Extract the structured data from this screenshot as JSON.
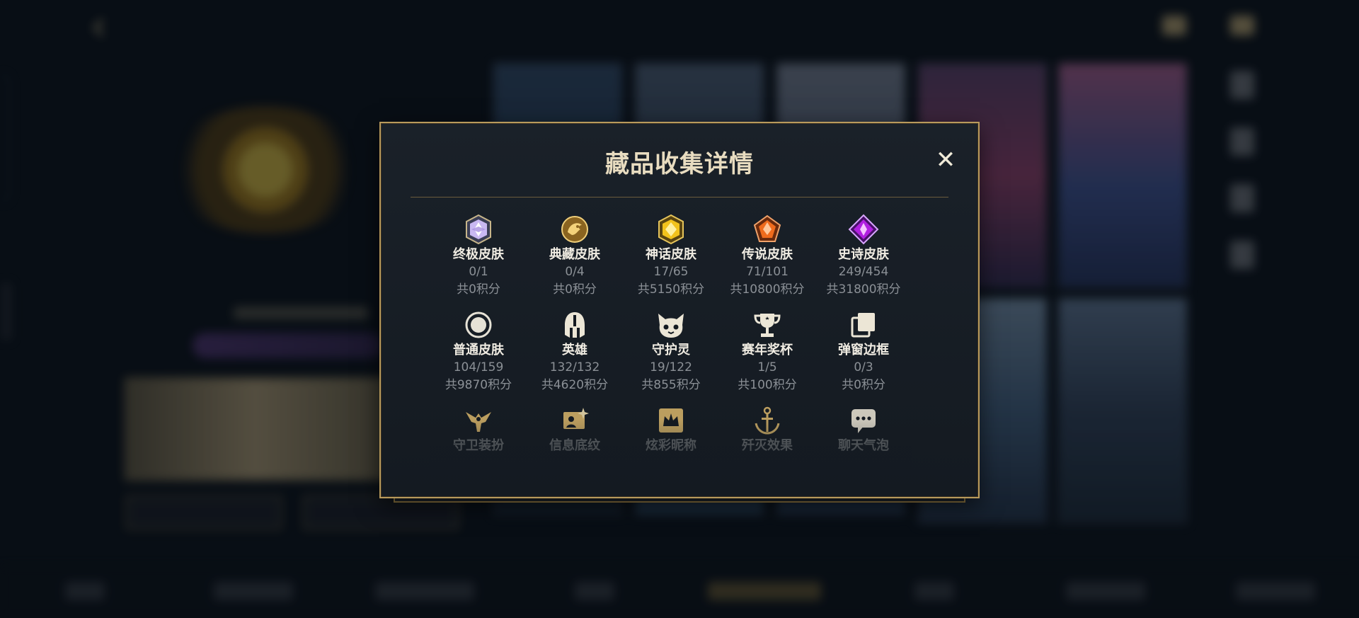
{
  "modal": {
    "title": "藏品收集详情",
    "close_label": "✕"
  },
  "categories": [
    {
      "label": "终极皮肤",
      "count": "0/1",
      "points": "共0积分",
      "icon": "ultimate-skin-icon"
    },
    {
      "label": "典藏皮肤",
      "count": "0/4",
      "points": "共0积分",
      "icon": "collector-skin-icon"
    },
    {
      "label": "神话皮肤",
      "count": "17/65",
      "points": "共5150积分",
      "icon": "mythic-skin-icon"
    },
    {
      "label": "传说皮肤",
      "count": "71/101",
      "points": "共10800积分",
      "icon": "legendary-skin-icon"
    },
    {
      "label": "史诗皮肤",
      "count": "249/454",
      "points": "共31800积分",
      "icon": "epic-skin-icon"
    },
    {
      "label": "普通皮肤",
      "count": "104/159",
      "points": "共9870积分",
      "icon": "normal-skin-icon"
    },
    {
      "label": "英雄",
      "count": "132/132",
      "points": "共4620积分",
      "icon": "hero-helmet-icon"
    },
    {
      "label": "守护灵",
      "count": "19/122",
      "points": "共855积分",
      "icon": "guardian-spirit-icon"
    },
    {
      "label": "赛年奖杯",
      "count": "1/5",
      "points": "共100积分",
      "icon": "season-trophy-icon"
    },
    {
      "label": "弹窗边框",
      "count": "0/3",
      "points": "共0积分",
      "icon": "popup-frame-icon"
    },
    {
      "label": "守卫装扮",
      "icon": "guard-outfit-icon"
    },
    {
      "label": "信息底纹",
      "icon": "info-pattern-icon"
    },
    {
      "label": "炫彩昵称",
      "icon": "colorful-nickname-icon"
    },
    {
      "label": "歼灭效果",
      "icon": "annihilation-effect-icon"
    },
    {
      "label": "聊天气泡",
      "icon": "chat-bubble-icon"
    }
  ],
  "colors": {
    "frame_gold": "#b89a5c",
    "panel_bg": "#1a2129",
    "title_text": "#e8dcc0",
    "muted_text": "#8b9096",
    "icon_gold": "#d9b56a"
  }
}
